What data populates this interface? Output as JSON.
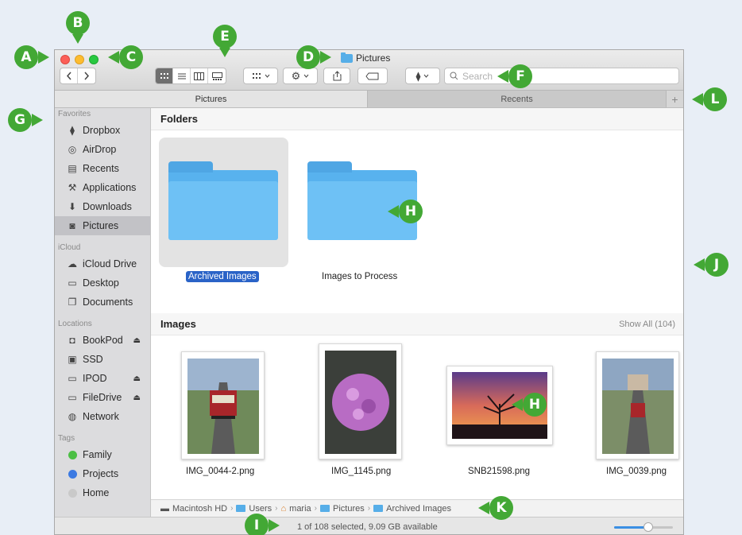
{
  "window": {
    "title": "Pictures"
  },
  "toolbar": {
    "back_icon": "chevron-left-icon",
    "forward_icon": "chevron-right-icon",
    "view_modes": [
      "icon-view-icon",
      "list-view-icon",
      "column-view-icon",
      "gallery-view-icon"
    ],
    "active_view": "icon-view-icon",
    "group_icon": "group-by-icon",
    "action_icon": "gear-icon",
    "share_icon": "share-icon",
    "tag_icon": "tag-icon",
    "dropbox_icon": "dropbox-icon",
    "search_placeholder": "Search"
  },
  "tabs": [
    {
      "label": "Pictures",
      "active": true
    },
    {
      "label": "Recents",
      "active": false
    }
  ],
  "sidebar": {
    "favorites_label": "Favorites",
    "favorites": [
      {
        "label": "Dropbox",
        "icon": "dropbox-icon"
      },
      {
        "label": "AirDrop",
        "icon": "airdrop-icon"
      },
      {
        "label": "Recents",
        "icon": "recents-icon"
      },
      {
        "label": "Applications",
        "icon": "applications-icon"
      },
      {
        "label": "Downloads",
        "icon": "downloads-icon"
      },
      {
        "label": "Pictures",
        "icon": "camera-icon",
        "selected": true
      }
    ],
    "icloud_label": "iCloud",
    "icloud": [
      {
        "label": "iCloud Drive",
        "icon": "cloud-icon"
      },
      {
        "label": "Desktop",
        "icon": "desktop-icon"
      },
      {
        "label": "Documents",
        "icon": "documents-icon"
      }
    ],
    "locations_label": "Locations",
    "locations": [
      {
        "label": "BookPod",
        "icon": "disk-icon",
        "eject": "⏏"
      },
      {
        "label": "SSD",
        "icon": "drive-icon"
      },
      {
        "label": "IPOD",
        "icon": "drive-icon",
        "eject": "⏏"
      },
      {
        "label": "FileDrive",
        "icon": "drive-icon",
        "eject": "⏏"
      },
      {
        "label": "Network",
        "icon": "globe-icon"
      }
    ],
    "tags_label": "Tags",
    "tags": [
      {
        "label": "Family",
        "color": "#4cbf45"
      },
      {
        "label": "Projects",
        "color": "#3c7ae2"
      },
      {
        "label": "Home",
        "color": "#c9c9c9"
      }
    ]
  },
  "main": {
    "folders_heading": "Folders",
    "folders": [
      {
        "label": "Archived Images",
        "selected": true
      },
      {
        "label": "Images to Process",
        "selected": false
      }
    ],
    "images_heading": "Images",
    "show_all": "Show All (104)",
    "images": [
      {
        "label": "IMG_0044-2.png"
      },
      {
        "label": "IMG_1145.png"
      },
      {
        "label": "SNB21598.png"
      },
      {
        "label": "IMG_0039.png"
      }
    ]
  },
  "pathbar": {
    "segments": [
      "Macintosh HD",
      "Users",
      "maria",
      "Pictures",
      "Archived Images"
    ],
    "separator": "›"
  },
  "status": {
    "text": "1 of 108 selected, 9.09 GB available",
    "zoom_level": 0.58
  },
  "callouts": [
    "A",
    "B",
    "C",
    "D",
    "E",
    "F",
    "G",
    "H",
    "I",
    "J",
    "K",
    "L"
  ],
  "colors": {
    "accent": "#2a63c7",
    "callout": "#43a835",
    "folder": "#58b2ee"
  }
}
